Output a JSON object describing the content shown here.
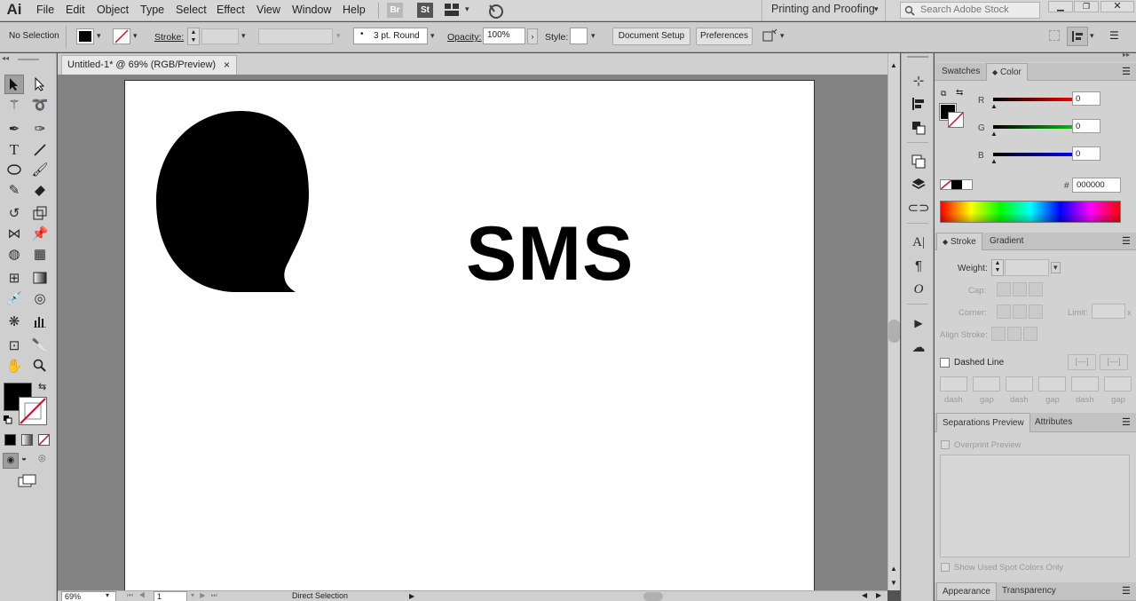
{
  "app": {
    "logo": "Ai"
  },
  "menu": [
    "File",
    "Edit",
    "Object",
    "Type",
    "Select",
    "Effect",
    "View",
    "Window",
    "Help"
  ],
  "menubar": {
    "bridge_label": "Br",
    "stock_label": "St",
    "workspace": "Printing and Proofing",
    "search_placeholder": "Search Adobe Stock"
  },
  "control": {
    "selection": "No Selection",
    "stroke_label": "Stroke:",
    "brush_value": "3 pt. Round",
    "opacity_label": "Opacity:",
    "opacity_value": "100%",
    "style_label": "Style:",
    "doc_setup": "Document Setup",
    "preferences": "Preferences"
  },
  "document": {
    "tab_title": "Untitled-1* @ 69% (RGB/Preview)",
    "close": "×"
  },
  "artwork": {
    "text": "SMS"
  },
  "status": {
    "zoom": "69%",
    "page": "1",
    "tool": "Direct Selection"
  },
  "color_panel": {
    "tabs": [
      "Swatches",
      "Color"
    ],
    "r_label": "R",
    "g_label": "G",
    "b_label": "B",
    "r_value": "0",
    "g_value": "0",
    "b_value": "0",
    "hash": "#",
    "hex": "000000"
  },
  "stroke_panel": {
    "tabs": [
      "Stroke",
      "Gradient"
    ],
    "weight_label": "Weight:",
    "cap_label": "Cap:",
    "corner_label": "Corner:",
    "limit_label": "Limit:",
    "limit_x": "x",
    "align_label": "Align Stroke:",
    "dashed_label": "Dashed Line",
    "dash_labels": [
      "dash",
      "gap",
      "dash",
      "gap",
      "dash",
      "gap"
    ]
  },
  "sep_panel": {
    "tabs": [
      "Separations Preview",
      "Transparency"
    ],
    "tabs_short": [
      "Separations Preview",
      "Attributes"
    ],
    "overprint": "Overprint Preview",
    "spot": "Show Used Spot Colors Only"
  },
  "bottom_tabs": [
    "Appearance",
    "Transparency"
  ],
  "colors": {
    "accent_red": "#c8102e",
    "fill": "#000000"
  }
}
